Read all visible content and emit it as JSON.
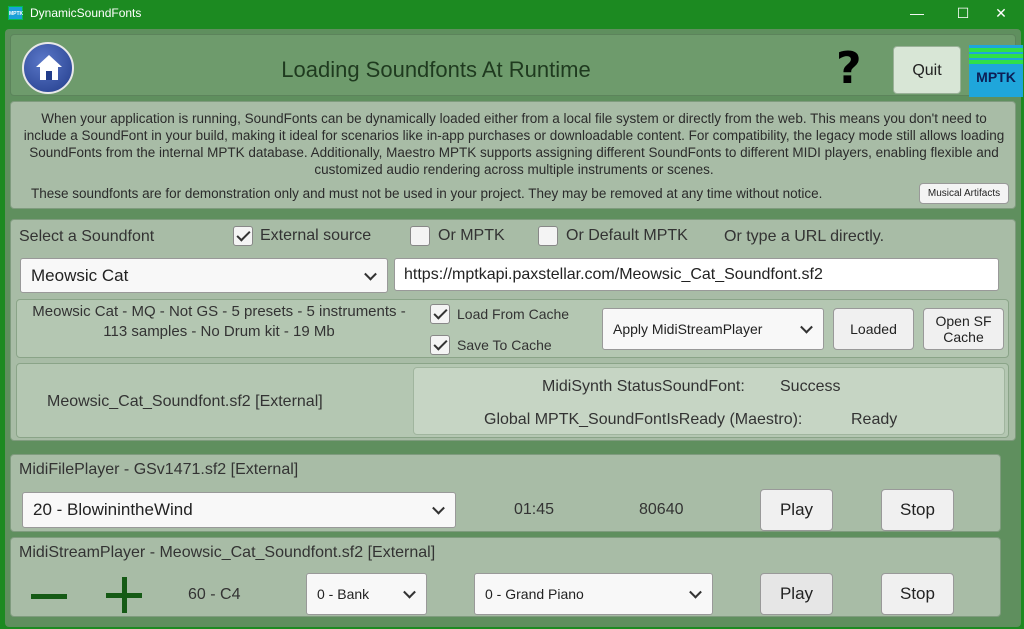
{
  "window": {
    "title": "DynamicSoundFonts",
    "app_icon_text": "MPTK",
    "minimize": "—",
    "maximize": "☐",
    "close": "✕"
  },
  "header": {
    "title": "Loading Soundfonts At Runtime",
    "help": "?",
    "quit_label": "Quit",
    "logo_text": "MPTK"
  },
  "description": {
    "text": "When your application is running, SoundFonts can be dynamically loaded either from a local file system or directly from the web. This means you don't need to include a SoundFont in your build, making it ideal for scenarios like in-app purchases or downloadable content. For compatibility, the legacy mode still allows loading SoundFonts from the internal MPTK database. Additionally, Maestro MPTK supports assigning different SoundFonts to different MIDI players, enabling flexible and customized audio rendering across multiple instruments or scenes.",
    "note": "These soundfonts are for demonstration only and must not be used in your project. They may be removed at any time without notice.",
    "artifacts_button": "Musical Artifacts"
  },
  "soundfont": {
    "select_label": "Select a Soundfont",
    "external_source": {
      "label": "External source",
      "checked": true
    },
    "or_mptk": {
      "label": "Or MPTK",
      "checked": false
    },
    "or_default": {
      "label": "Or Default MPTK",
      "checked": false
    },
    "url_hint": "Or type a URL directly.",
    "selected": "Meowsic Cat",
    "url": "https://mptkapi.paxstellar.com/Meowsic_Cat_Soundfont.sf2",
    "info": "Meowsic Cat - MQ - Not GS - 5 presets - 5 instruments - 113 samples - No Drum kit - 19 Mb",
    "load_from_cache": {
      "label": "Load From Cache",
      "checked": true
    },
    "save_to_cache": {
      "label": "Save To Cache",
      "checked": true
    },
    "apply_target": "Apply MidiStreamPlayer",
    "loaded_button": "Loaded",
    "open_cache_button": "Open SF Cache",
    "loaded_file": "Meowsic_Cat_Soundfont.sf2 [External]",
    "status_label": "MidiSynth StatusSoundFont:",
    "status_value": "Success",
    "global_label": "Global MPTK_SoundFontIsReady (Maestro):",
    "global_value": "Ready"
  },
  "midi_file_player": {
    "title": "MidiFilePlayer - GSv1471.sf2 [External]",
    "selected_midi": "20 - BlowinintheWind",
    "time": "01:45",
    "ticks": "80640",
    "play": "Play",
    "stop": "Stop"
  },
  "midi_stream_player": {
    "title": "MidiStreamPlayer - Meowsic_Cat_Soundfont.sf2 [External]",
    "note": "60 - C4",
    "bank": "0 - Bank",
    "preset": "0 - Grand Piano",
    "play": "Play",
    "stop": "Stop"
  },
  "colors": {
    "frame": "#1c8a21",
    "panel": "#a8bca6",
    "success": "#2b9b2b"
  }
}
